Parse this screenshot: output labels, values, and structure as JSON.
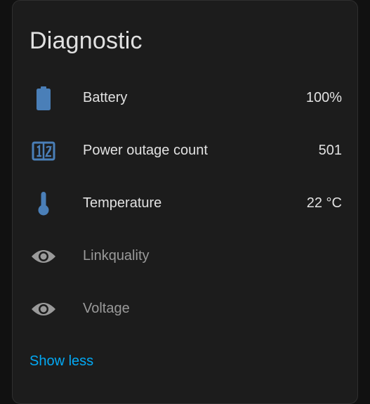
{
  "card": {
    "title": "Diagnostic",
    "rows": [
      {
        "icon": "battery-icon",
        "label": "Battery",
        "value": "100%",
        "icon_color": "#4a7fb8"
      },
      {
        "icon": "counter-icon",
        "label": "Power outage count",
        "value": "501",
        "icon_color": "#4a7fb8"
      },
      {
        "icon": "thermometer-icon",
        "label": "Temperature",
        "value": "22 °C",
        "icon_color": "#4a7fb8"
      },
      {
        "icon": "eye-icon",
        "label": "Linkquality",
        "value": "",
        "icon_color": "#9a9a9a"
      },
      {
        "icon": "eye-icon",
        "label": "Voltage",
        "value": "",
        "icon_color": "#9a9a9a"
      }
    ],
    "show_less_label": "Show less"
  },
  "colors": {
    "background": "#111111",
    "card": "#1c1c1c",
    "text": "#e1e1e1",
    "muted": "#9a9a9a",
    "accent": "#03a9f4",
    "icon_active": "#4a7fb8"
  }
}
